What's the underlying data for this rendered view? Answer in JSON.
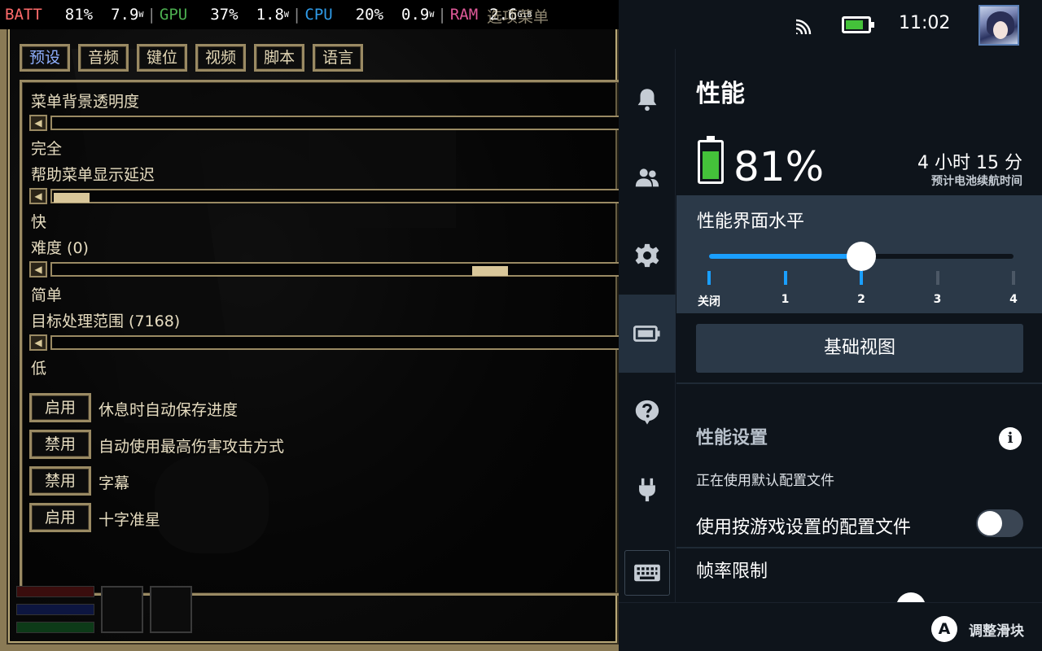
{
  "osd": {
    "batt_label": "BATT",
    "batt_pct": "81%",
    "batt_watts": "7.9",
    "batt_unit": "W",
    "gpu_label": "GPU",
    "gpu_pct": "37%",
    "gpu_watts": "1.8",
    "gpu_unit": "W",
    "cpu_label": "CPU",
    "cpu_pct": "20%",
    "cpu_watts": "0.9",
    "cpu_unit": "W",
    "ram_label": "RAM",
    "ram_value": "2.6",
    "ram_unit": "GiB",
    "overlap_text": "选项菜单"
  },
  "game": {
    "tabs": [
      {
        "label": "预设",
        "active": true
      },
      {
        "label": "音频",
        "active": false
      },
      {
        "label": "键位",
        "active": false
      },
      {
        "label": "视频",
        "active": false
      },
      {
        "label": "脚本",
        "active": false
      },
      {
        "label": "语言",
        "active": false
      }
    ],
    "sliders": [
      {
        "label": "菜单背景透明度",
        "value_text": "完全",
        "position": 0.0
      },
      {
        "label": "帮助菜单显示延迟",
        "value_text": "快",
        "position": 0.0
      },
      {
        "label": "难度 (0)",
        "value_text": "简单",
        "position": 0.79
      },
      {
        "label": "目标处理范围 (7168)",
        "value_text": "低",
        "position": null
      }
    ],
    "toggles": [
      {
        "state": "启用",
        "label": "休息时自动保存进度"
      },
      {
        "state": "禁用",
        "label": "自动使用最高伤害攻击方式"
      },
      {
        "state": "禁用",
        "label": "字幕"
      },
      {
        "state": "启用",
        "label": "十字准星"
      }
    ],
    "colors": {
      "text": "#e6dcc0",
      "frame": "#9a8a63",
      "active_tab": "#8fb0ff",
      "slider_thumb": "#d9c79a"
    }
  },
  "qam": {
    "status": {
      "cast_icon": "cast-icon",
      "battery_icon": "battery-icon",
      "battery_level": 0.81,
      "time": "11:02",
      "avatar_icon": "avatar-icon"
    },
    "nav": [
      {
        "icon": "bell-icon",
        "active": false
      },
      {
        "icon": "friends-icon",
        "active": false
      },
      {
        "icon": "gear-icon",
        "active": false
      },
      {
        "icon": "battery-icon",
        "active": true
      },
      {
        "icon": "help-icon",
        "active": false
      },
      {
        "icon": "plug-icon",
        "active": false
      }
    ],
    "keyboard_icon": "keyboard-icon",
    "performance": {
      "title": "性能",
      "battery_pct": "81%",
      "battery_level": 0.81,
      "runtime": "4 小时 15 分",
      "runtime_caption": "预计电池续航时间",
      "overlay_label": "性能界面水平",
      "overlay_ticks": [
        "关闭",
        "1",
        "2",
        "3",
        "4"
      ],
      "overlay_value_index": 2,
      "basic_view_button": "基础视图",
      "settings_heading": "性能设置",
      "info_icon": "info-icon",
      "profile_status": "正在使用默认配置文件",
      "per_game_profile_label": "使用按游戏设置的配置文件",
      "per_game_profile_enabled": false,
      "fps_limit_label": "帧率限制"
    },
    "footer": {
      "button_glyph": "A",
      "action_label": "调整滑块"
    },
    "colors": {
      "accent": "#1a9fff",
      "panel_bg": "#0e141b",
      "section_bg": "#2b3948",
      "battery_green": "#44c23a"
    }
  }
}
